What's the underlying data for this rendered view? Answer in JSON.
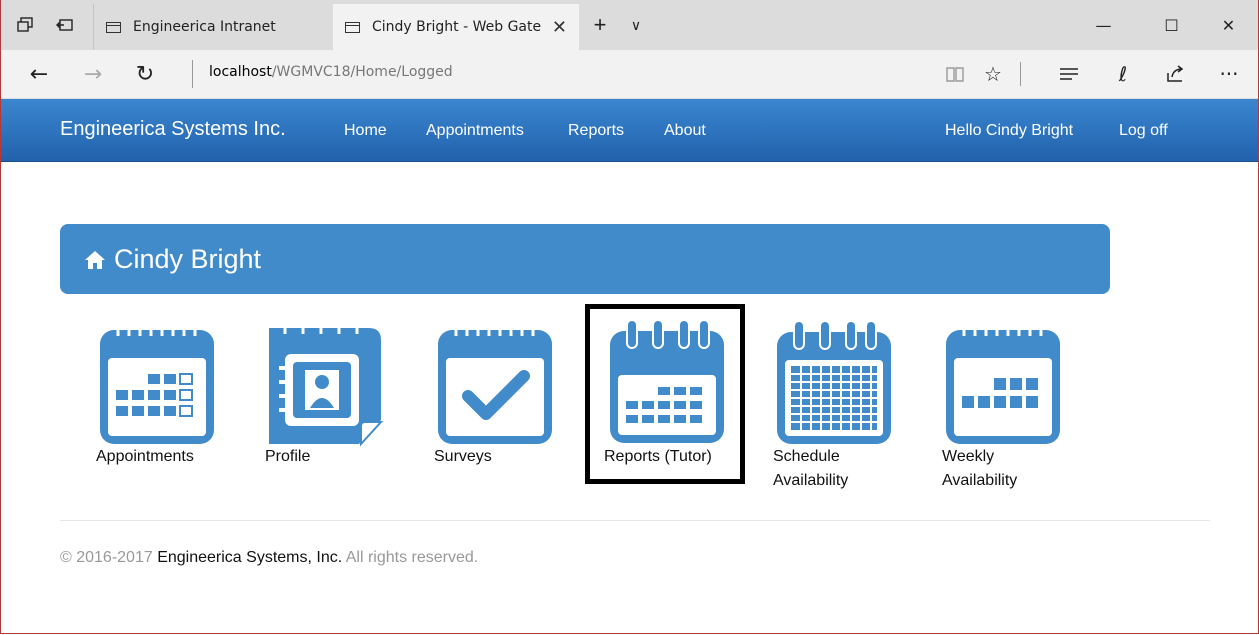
{
  "browser": {
    "tabs": [
      {
        "title": "Engineerica Intranet"
      },
      {
        "title": "Cindy Bright - Web Gate"
      }
    ],
    "new_tab": "+",
    "tab_list": "∨",
    "controls": {
      "minimize": "—",
      "maximize": "☐",
      "close": "✕"
    },
    "url_host": "localhost",
    "url_path": "/WGMVC18/Home/Logged"
  },
  "site": {
    "brand": "Engineerica Systems Inc.",
    "nav": [
      "Home",
      "Appointments",
      "Reports",
      "About"
    ],
    "greeting": "Hello Cindy Bright",
    "logoff": "Log off"
  },
  "panel": {
    "title": "Cindy Bright"
  },
  "tiles": [
    {
      "label": "Appointments"
    },
    {
      "label": "Profile"
    },
    {
      "label": "Surveys"
    },
    {
      "label": "Reports (Tutor)"
    },
    {
      "label_line1": "Schedule",
      "label_line2": "Availability"
    },
    {
      "label_line1": "Weekly",
      "label_line2": "Availability"
    }
  ],
  "footer": {
    "prefix": "© 2016-2017 ",
    "company": "Engineerica Systems, Inc.",
    "suffix": " All rights reserved."
  },
  "colors": {
    "accent": "#428bca",
    "navbar_top": "#3a86cf",
    "navbar_bottom": "#2262ad"
  }
}
